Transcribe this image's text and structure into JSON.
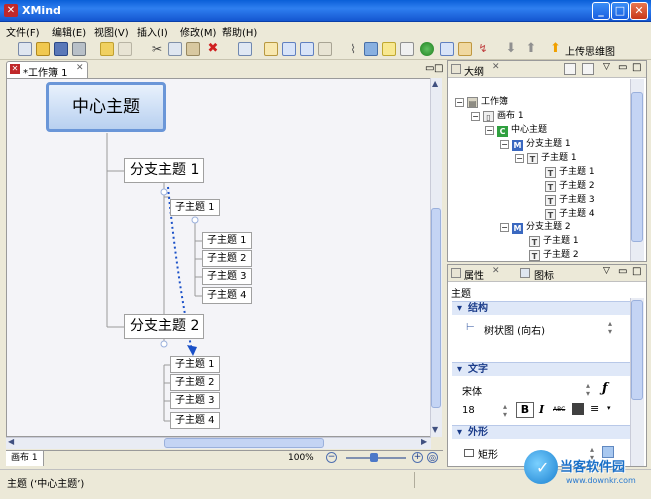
{
  "window": {
    "title": "XMind",
    "min": "_",
    "max": "□",
    "close": "✕"
  },
  "menu": [
    "文件(F)",
    "编辑(E)",
    "视图(V)",
    "插入(I)",
    "修改(M)",
    "帮助(H)"
  ],
  "toolbar": {
    "upload_label": "上传思维图"
  },
  "editor": {
    "tab_label": "*工作簿 1",
    "sheet_tab": "画布 1",
    "zoom": "100%"
  },
  "map": {
    "central": "中心主题",
    "branch1": "分支主题 1",
    "branch2": "分支主题 2",
    "floating_sub": "子主题 1",
    "b1_subs": [
      "子主题 1",
      "子主题 2",
      "子主题 3",
      "子主题 4"
    ],
    "b2_subs": [
      "子主题 1",
      "子主题 2",
      "子主题 3",
      "子主题 4"
    ]
  },
  "outline": {
    "title": "大纲",
    "items": [
      "工作簿",
      "画布 1",
      "中心主题",
      "分支主题 1",
      "子主题 1",
      "子主题 1",
      "子主题 2",
      "子主题 3",
      "子主题 4",
      "分支主题 2",
      "子主题 1",
      "子主题 2"
    ]
  },
  "properties": {
    "tab1": "属性",
    "tab2": "图标",
    "heading": "主题",
    "structure_section": "结构",
    "structure_value": "树状图 (向右)",
    "text_section": "文字",
    "font_name": "宋体",
    "font_size": "18",
    "bold": "B",
    "italic": "I",
    "strike": "ABC",
    "shape_section": "外形",
    "shape_value": "矩形"
  },
  "status": {
    "text": "主题 (‘中心主题’)"
  },
  "watermark": {
    "brand": "当客软件园",
    "url": "www.downkr.com"
  },
  "colors": {
    "title_bar": "#1456d0",
    "accent_blue": "#6a96d8",
    "relationship": "#1a50c8"
  }
}
